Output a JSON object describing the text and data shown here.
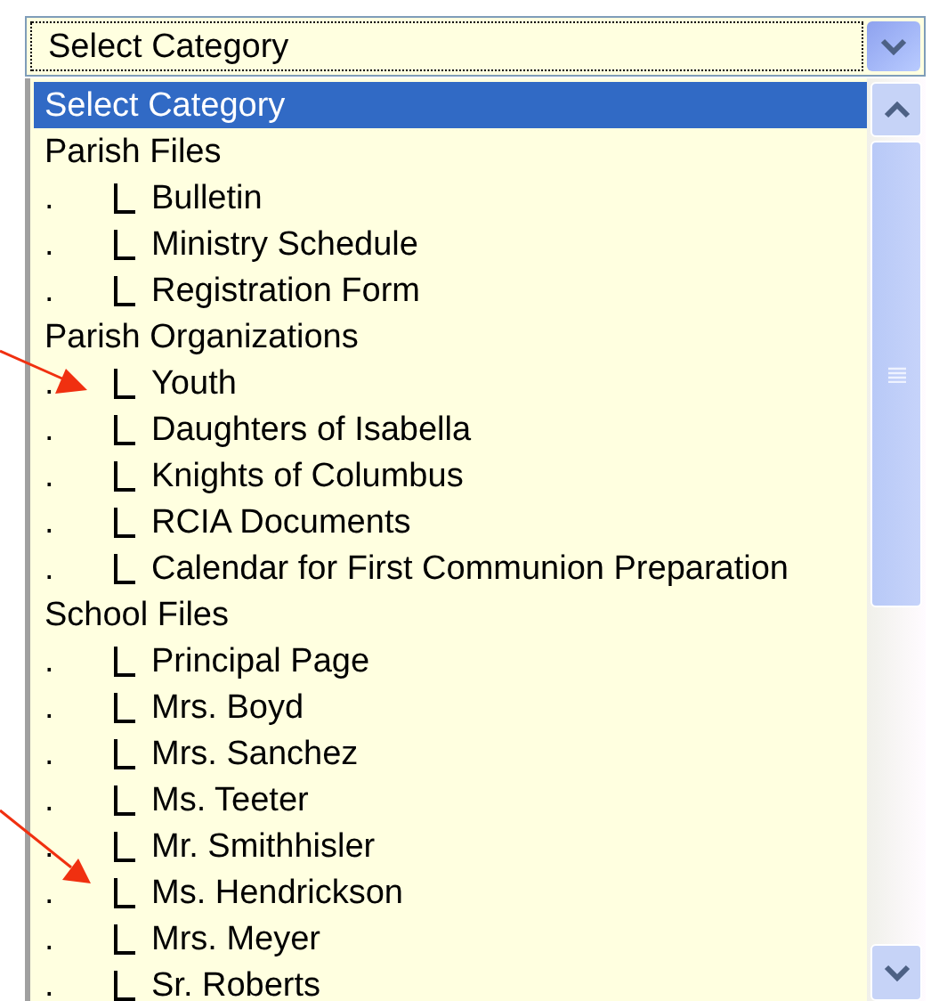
{
  "select": {
    "value": "Select Category"
  },
  "options": [
    {
      "label": "Select Category",
      "selected": true
    },
    {
      "label": "Parish Files",
      "selected": false,
      "children": [
        {
          "marker": ".",
          "label": "Bulletin",
          "selected": false
        },
        {
          "marker": ".",
          "label": "Ministry Schedule",
          "selected": false
        },
        {
          "marker": ".",
          "label": "Registration Form",
          "selected": false
        }
      ]
    },
    {
      "label": "Parish Organizations",
      "selected": false,
      "children": [
        {
          "marker": ".",
          "label": "Youth",
          "selected": false
        },
        {
          "marker": ".",
          "label": "Daughters of Isabella",
          "selected": false
        },
        {
          "marker": ".",
          "label": "Knights of Columbus",
          "selected": false
        },
        {
          "marker": ".",
          "label": "RCIA Documents",
          "selected": false
        },
        {
          "marker": ".",
          "label": "Calendar for First Communion Preparation",
          "selected": false
        }
      ]
    },
    {
      "label": "School Files",
      "selected": false,
      "children": [
        {
          "marker": ".",
          "label": "Principal Page",
          "selected": false
        },
        {
          "marker": ".",
          "label": "Mrs. Boyd",
          "selected": false
        },
        {
          "marker": ".",
          "label": "Mrs. Sanchez",
          "selected": false
        },
        {
          "marker": ".",
          "label": "Ms. Teeter",
          "selected": false
        },
        {
          "marker": ".",
          "label": "Mr. Smithhisler",
          "selected": false
        },
        {
          "marker": ".",
          "label": "Ms. Hendrickson",
          "selected": false
        },
        {
          "marker": ".",
          "label": "Mrs. Meyer",
          "selected": false
        },
        {
          "marker": ".",
          "label": "Sr. Roberts",
          "selected": false
        }
      ]
    }
  ]
}
